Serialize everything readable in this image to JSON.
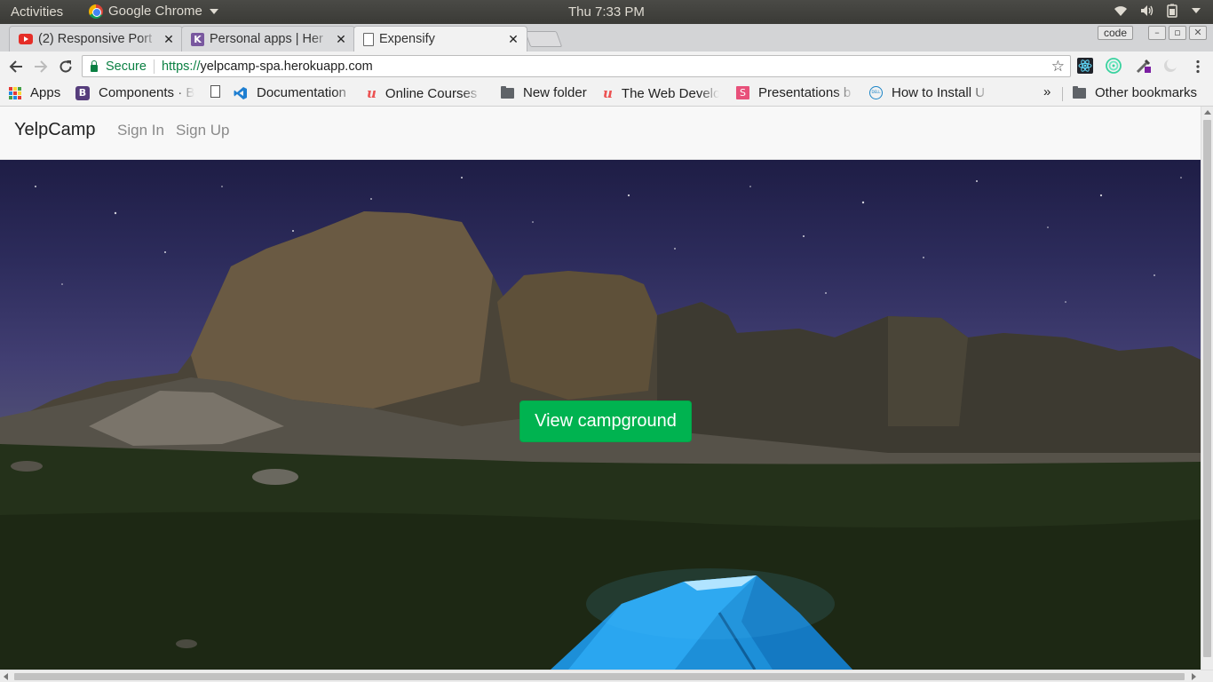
{
  "system_bar": {
    "activities": "Activities",
    "app_name": "Google Chrome",
    "clock": "Thu  7:33 PM"
  },
  "tabs": [
    {
      "title": "(2) Responsive Port",
      "favicon": "youtube-icon"
    },
    {
      "title": "Personal apps | Her",
      "favicon": "heroku-icon"
    },
    {
      "title": "Expensify",
      "favicon": "document-icon",
      "active": true
    }
  ],
  "window": {
    "profile": "code"
  },
  "omnibox": {
    "secure_label": "Secure",
    "scheme": "https://",
    "host": "yelpcamp-spa.herokuapp.com"
  },
  "bookmarks": [
    {
      "label": "Apps",
      "icon": "apps-grid-icon"
    },
    {
      "label": "Components · B",
      "icon": "bootstrap-icon"
    },
    {
      "label": "",
      "icon": "document-icon"
    },
    {
      "label": "Documentation",
      "icon": "vscode-icon"
    },
    {
      "label": "Online Courses",
      "icon": "udemy-icon"
    },
    {
      "label": "New folder",
      "icon": "folder-icon"
    },
    {
      "label": "The Web Develo",
      "icon": "udemy-icon"
    },
    {
      "label": "Presentations b",
      "icon": "slides-icon"
    },
    {
      "label": "How to Install U",
      "icon": "dell-icon"
    }
  ],
  "bookmarks_overflow": "»",
  "other_bookmarks": "Other bookmarks",
  "page": {
    "brand": "YelpCamp",
    "nav_links": [
      "Sign In",
      "Sign Up"
    ],
    "cta_label": "View campground",
    "cta_color": "#00b350"
  }
}
